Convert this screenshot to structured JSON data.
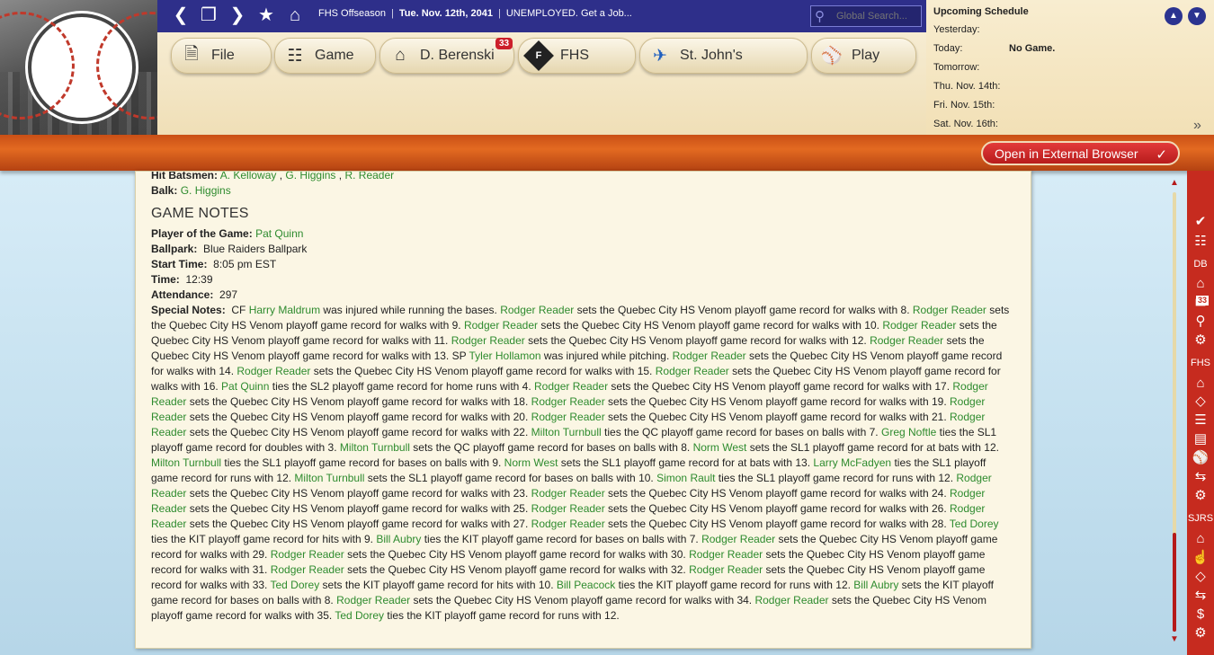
{
  "topbar": {
    "breadcrumb": [
      "FHS Offseason",
      "Tue. Nov. 12th, 2041",
      "UNEMPLOYED. Get a Job..."
    ],
    "search_placeholder": "Global Search..."
  },
  "tabs": [
    {
      "label": "File",
      "icon": "file-icon"
    },
    {
      "label": "Game",
      "icon": "globe-icon"
    },
    {
      "label": "D. Berenski",
      "icon": "home-icon",
      "badge": "33"
    },
    {
      "label": "FHS",
      "icon": "fhs-logo-icon",
      "logo_letter": "F"
    },
    {
      "label": "St. John's",
      "icon": "st-johns-logo-icon"
    },
    {
      "label": "Play",
      "icon": "baseball-icon"
    }
  ],
  "schedule": {
    "title": "Upcoming Schedule",
    "rows": [
      {
        "day": "Yesterday:",
        "value": ""
      },
      {
        "day": "Today:",
        "value": "No Game."
      },
      {
        "day": "Tomorrow:",
        "value": ""
      },
      {
        "day": "Thu. Nov. 14th:",
        "value": ""
      },
      {
        "day": "Fri. Nov. 15th:",
        "value": ""
      },
      {
        "day": "Sat. Nov. 16th:",
        "value": ""
      }
    ]
  },
  "external_button": "Open in External Browser",
  "report": {
    "hit_batsmen_label": "Hit Batsmen:",
    "hit_batsmen": [
      "A. Kelloway",
      "G. Higgins",
      "R. Reader"
    ],
    "balk_label": "Balk:",
    "balk": "G. Higgins",
    "notes_heading": "GAME NOTES",
    "player_of_game_label": "Player of the Game:",
    "player_of_game": "Pat Quinn",
    "ballpark_label": "Ballpark:",
    "ballpark": "Blue Raiders Ballpark",
    "start_time_label": "Start Time:",
    "start_time": "8:05 pm EST",
    "time_label": "Time:",
    "time": "12:39",
    "attendance_label": "Attendance:",
    "attendance": "297",
    "special_notes_label": "Special Notes:",
    "special_notes": [
      {
        "t": "CF "
      },
      {
        "p": "Harry Maldrum"
      },
      {
        "t": " was injured while running the bases. "
      },
      {
        "p": "Rodger Reader"
      },
      {
        "t": " sets the Quebec City HS Venom playoff game record for walks with 8. "
      },
      {
        "p": "Rodger Reader"
      },
      {
        "t": " sets the Quebec City HS Venom playoff game record for walks with 9. "
      },
      {
        "p": "Rodger Reader"
      },
      {
        "t": " sets the Quebec City HS Venom playoff game record for walks with 10. "
      },
      {
        "p": "Rodger Reader"
      },
      {
        "t": " sets the Quebec City HS Venom playoff game record for walks with 11. "
      },
      {
        "p": "Rodger Reader"
      },
      {
        "t": " sets the Quebec City HS Venom playoff game record for walks with 12. "
      },
      {
        "p": "Rodger Reader"
      },
      {
        "t": " sets the Quebec City HS Venom playoff game record for walks with 13. SP "
      },
      {
        "p": "Tyler Hollamon"
      },
      {
        "t": " was injured while pitching. "
      },
      {
        "p": "Rodger Reader"
      },
      {
        "t": " sets the Quebec City HS Venom playoff game record for walks with 14. "
      },
      {
        "p": "Rodger Reader"
      },
      {
        "t": " sets the Quebec City HS Venom playoff game record for walks with 15. "
      },
      {
        "p": "Rodger Reader"
      },
      {
        "t": " sets the Quebec City HS Venom playoff game record for walks with 16. "
      },
      {
        "p": "Pat Quinn"
      },
      {
        "t": " ties the SL2 playoff game record for home runs with 4. "
      },
      {
        "p": "Rodger Reader"
      },
      {
        "t": " sets the Quebec City HS Venom playoff game record for walks with 17. "
      },
      {
        "p": "Rodger Reader"
      },
      {
        "t": " sets the Quebec City HS Venom playoff game record for walks with 18. "
      },
      {
        "p": "Rodger Reader"
      },
      {
        "t": " sets the Quebec City HS Venom playoff game record for walks with 19. "
      },
      {
        "p": "Rodger Reader"
      },
      {
        "t": " sets the Quebec City HS Venom playoff game record for walks with 20. "
      },
      {
        "p": "Rodger Reader"
      },
      {
        "t": " sets the Quebec City HS Venom playoff game record for walks with 21. "
      },
      {
        "p": "Rodger Reader"
      },
      {
        "t": " sets the Quebec City HS Venom playoff game record for walks with 22. "
      },
      {
        "p": "Milton Turnbull"
      },
      {
        "t": " ties the QC playoff game record for bases on balls with 7. "
      },
      {
        "p": "Greg Noftle"
      },
      {
        "t": " ties the SL1 playoff game record for doubles with 3. "
      },
      {
        "p": "Milton Turnbull"
      },
      {
        "t": " sets the QC playoff game record for bases on balls with 8. "
      },
      {
        "p": "Norm West"
      },
      {
        "t": " sets the SL1 playoff game record for at bats with 12. "
      },
      {
        "p": "Milton Turnbull"
      },
      {
        "t": " ties the SL1 playoff game record for bases on balls with 9. "
      },
      {
        "p": "Norm West"
      },
      {
        "t": " sets the SL1 playoff game record for at bats with 13. "
      },
      {
        "p": "Larry McFadyen"
      },
      {
        "t": " ties the SL1 playoff game record for runs with 12. "
      },
      {
        "p": "Milton Turnbull"
      },
      {
        "t": " sets the SL1 playoff game record for bases on balls with 10. "
      },
      {
        "p": "Simon Rault"
      },
      {
        "t": " ties the SL1 playoff game record for runs with 12. "
      },
      {
        "p": "Rodger Reader"
      },
      {
        "t": " sets the Quebec City HS Venom playoff game record for walks with 23. "
      },
      {
        "p": "Rodger Reader"
      },
      {
        "t": " sets the Quebec City HS Venom playoff game record for walks with 24. "
      },
      {
        "p": "Rodger Reader"
      },
      {
        "t": " sets the Quebec City HS Venom playoff game record for walks with 25. "
      },
      {
        "p": "Rodger Reader"
      },
      {
        "t": " sets the Quebec City HS Venom playoff game record for walks with 26. "
      },
      {
        "p": "Rodger Reader"
      },
      {
        "t": " sets the Quebec City HS Venom playoff game record for walks with 27. "
      },
      {
        "p": "Rodger Reader"
      },
      {
        "t": " sets the Quebec City HS Venom playoff game record for walks with 28. "
      },
      {
        "p": "Ted Dorey"
      },
      {
        "t": " ties the KIT playoff game record for hits with 9. "
      },
      {
        "p": "Bill Aubry"
      },
      {
        "t": " ties the KIT playoff game record for bases on balls with 7. "
      },
      {
        "p": "Rodger Reader"
      },
      {
        "t": " sets the Quebec City HS Venom playoff game record for walks with 29. "
      },
      {
        "p": "Rodger Reader"
      },
      {
        "t": " sets the Quebec City HS Venom playoff game record for walks with 30. "
      },
      {
        "p": "Rodger Reader"
      },
      {
        "t": " sets the Quebec City HS Venom playoff game record for walks with 31. "
      },
      {
        "p": "Rodger Reader"
      },
      {
        "t": " sets the Quebec City HS Venom playoff game record for walks with 32. "
      },
      {
        "p": "Rodger Reader"
      },
      {
        "t": " sets the Quebec City HS Venom playoff game record for walks with 33. "
      },
      {
        "p": "Ted Dorey"
      },
      {
        "t": " sets the KIT playoff game record for hits with 10. "
      },
      {
        "p": "Bill Peacock"
      },
      {
        "t": " ties the KIT playoff game record for runs with 12. "
      },
      {
        "p": "Bill Aubry"
      },
      {
        "t": " sets the KIT playoff game record for bases on balls with 8. "
      },
      {
        "p": "Rodger Reader"
      },
      {
        "t": " sets the Quebec City HS Venom playoff game record for walks with 34. "
      },
      {
        "p": "Rodger Reader"
      },
      {
        "t": " sets the Quebec City HS Venom playoff game record for walks with 35. "
      },
      {
        "p": "Ted Dorey"
      },
      {
        "t": " ties the KIT playoff game record for runs with 12."
      }
    ]
  },
  "sidebar": {
    "section_labels": [
      "DB",
      "FHS",
      "SJRS"
    ],
    "badge": "33"
  },
  "colors": {
    "topbar": "#2e2f8a",
    "link": "#2e8b2e",
    "sidebar": "#c62b1f",
    "plank": "#e36a21"
  }
}
